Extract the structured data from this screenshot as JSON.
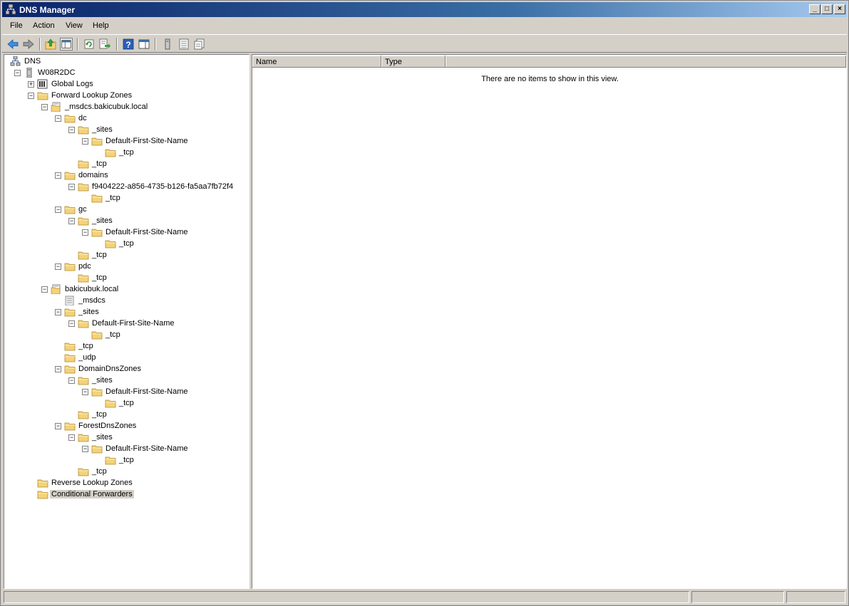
{
  "window": {
    "title": "DNS Manager"
  },
  "window_controls": {
    "minimize": "_",
    "maximize": "□",
    "close": "×"
  },
  "menu": [
    "File",
    "Action",
    "View",
    "Help"
  ],
  "toolbar": {
    "buttons": [
      "back-icon",
      "forward-icon",
      "up-icon",
      "show-hide-console-tree-icon",
      "refresh-icon",
      "export-list-icon",
      "help-icon",
      "action-pane-icon",
      "server-icon",
      "list-icon",
      "properties-icon"
    ]
  },
  "tree": [
    {
      "label": "DNS",
      "icon": "dns-icon",
      "depth": 0,
      "expander": ""
    },
    {
      "label": "W08R2DC",
      "icon": "server-icon",
      "depth": 1,
      "expander": "−"
    },
    {
      "label": "Global Logs",
      "icon": "log-icon",
      "depth": 2,
      "expander": "+"
    },
    {
      "label": "Forward Lookup Zones",
      "icon": "folder-icon",
      "depth": 2,
      "expander": "−"
    },
    {
      "label": "_msdcs.bakicubuk.local",
      "icon": "zone-icon",
      "depth": 3,
      "expander": "−"
    },
    {
      "label": "dc",
      "icon": "folder-icon",
      "depth": 4,
      "expander": "−"
    },
    {
      "label": "_sites",
      "icon": "folder-icon",
      "depth": 5,
      "expander": "−"
    },
    {
      "label": "Default-First-Site-Name",
      "icon": "folder-icon",
      "depth": 6,
      "expander": "−"
    },
    {
      "label": "_tcp",
      "icon": "folder-icon",
      "depth": 7,
      "expander": ""
    },
    {
      "label": "_tcp",
      "icon": "folder-icon",
      "depth": 5,
      "expander": ""
    },
    {
      "label": "domains",
      "icon": "folder-icon",
      "depth": 4,
      "expander": "−"
    },
    {
      "label": "f9404222-a856-4735-b126-fa5aa7fb72f4",
      "icon": "folder-icon",
      "depth": 5,
      "expander": "−"
    },
    {
      "label": "_tcp",
      "icon": "folder-icon",
      "depth": 6,
      "expander": ""
    },
    {
      "label": "gc",
      "icon": "folder-icon",
      "depth": 4,
      "expander": "−"
    },
    {
      "label": "_sites",
      "icon": "folder-icon",
      "depth": 5,
      "expander": "−"
    },
    {
      "label": "Default-First-Site-Name",
      "icon": "folder-icon",
      "depth": 6,
      "expander": "−"
    },
    {
      "label": "_tcp",
      "icon": "folder-icon",
      "depth": 7,
      "expander": ""
    },
    {
      "label": "_tcp",
      "icon": "folder-icon",
      "depth": 5,
      "expander": ""
    },
    {
      "label": "pdc",
      "icon": "folder-icon",
      "depth": 4,
      "expander": "−"
    },
    {
      "label": "_tcp",
      "icon": "folder-icon",
      "depth": 5,
      "expander": ""
    },
    {
      "label": "bakicubuk.local",
      "icon": "zone-icon",
      "depth": 3,
      "expander": "−"
    },
    {
      "label": "_msdcs",
      "icon": "delegated-zone-icon",
      "depth": 4,
      "expander": ""
    },
    {
      "label": "_sites",
      "icon": "folder-icon",
      "depth": 4,
      "expander": "−"
    },
    {
      "label": "Default-First-Site-Name",
      "icon": "folder-icon",
      "depth": 5,
      "expander": "−"
    },
    {
      "label": "_tcp",
      "icon": "folder-icon",
      "depth": 6,
      "expander": ""
    },
    {
      "label": "_tcp",
      "icon": "folder-icon",
      "depth": 4,
      "expander": ""
    },
    {
      "label": "_udp",
      "icon": "folder-icon",
      "depth": 4,
      "expander": ""
    },
    {
      "label": "DomainDnsZones",
      "icon": "folder-icon",
      "depth": 4,
      "expander": "−"
    },
    {
      "label": "_sites",
      "icon": "folder-icon",
      "depth": 5,
      "expander": "−"
    },
    {
      "label": "Default-First-Site-Name",
      "icon": "folder-icon",
      "depth": 6,
      "expander": "−"
    },
    {
      "label": "_tcp",
      "icon": "folder-icon",
      "depth": 7,
      "expander": ""
    },
    {
      "label": "_tcp",
      "icon": "folder-icon",
      "depth": 5,
      "expander": ""
    },
    {
      "label": "ForestDnsZones",
      "icon": "folder-icon",
      "depth": 4,
      "expander": "−"
    },
    {
      "label": "_sites",
      "icon": "folder-icon",
      "depth": 5,
      "expander": "−"
    },
    {
      "label": "Default-First-Site-Name",
      "icon": "folder-icon",
      "depth": 6,
      "expander": "−"
    },
    {
      "label": "_tcp",
      "icon": "folder-icon",
      "depth": 7,
      "expander": ""
    },
    {
      "label": "_tcp",
      "icon": "folder-icon",
      "depth": 5,
      "expander": ""
    },
    {
      "label": "Reverse Lookup Zones",
      "icon": "folder-icon",
      "depth": 2,
      "expander": ""
    },
    {
      "label": "Conditional Forwarders",
      "icon": "folder-icon",
      "depth": 2,
      "expander": "",
      "selected": true
    }
  ],
  "list": {
    "columns": [
      "Name",
      "Type"
    ],
    "empty_message": "There are no items to show in this view."
  },
  "colors": {
    "title_start": "#0a246a",
    "title_end": "#a6caf0",
    "folder": "#f4d27a",
    "chrome": "#d4d0c8"
  }
}
